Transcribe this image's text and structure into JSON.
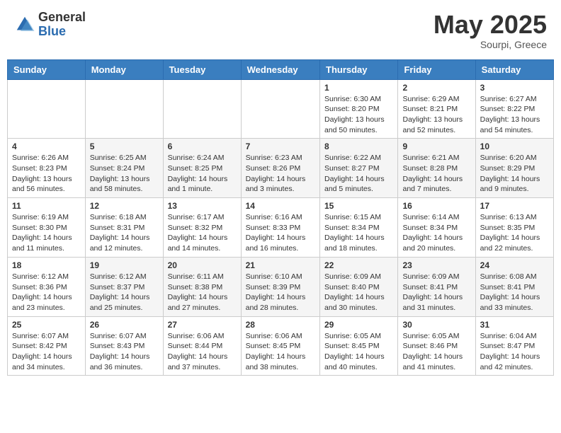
{
  "logo": {
    "general": "General",
    "blue": "Blue"
  },
  "title": "May 2025",
  "location": "Sourpi, Greece",
  "days_header": [
    "Sunday",
    "Monday",
    "Tuesday",
    "Wednesday",
    "Thursday",
    "Friday",
    "Saturday"
  ],
  "weeks": [
    [
      {
        "day": "",
        "info": ""
      },
      {
        "day": "",
        "info": ""
      },
      {
        "day": "",
        "info": ""
      },
      {
        "day": "",
        "info": ""
      },
      {
        "day": "1",
        "info": "Sunrise: 6:30 AM\nSunset: 8:20 PM\nDaylight: 13 hours\nand 50 minutes."
      },
      {
        "day": "2",
        "info": "Sunrise: 6:29 AM\nSunset: 8:21 PM\nDaylight: 13 hours\nand 52 minutes."
      },
      {
        "day": "3",
        "info": "Sunrise: 6:27 AM\nSunset: 8:22 PM\nDaylight: 13 hours\nand 54 minutes."
      }
    ],
    [
      {
        "day": "4",
        "info": "Sunrise: 6:26 AM\nSunset: 8:23 PM\nDaylight: 13 hours\nand 56 minutes."
      },
      {
        "day": "5",
        "info": "Sunrise: 6:25 AM\nSunset: 8:24 PM\nDaylight: 13 hours\nand 58 minutes."
      },
      {
        "day": "6",
        "info": "Sunrise: 6:24 AM\nSunset: 8:25 PM\nDaylight: 14 hours\nand 1 minute."
      },
      {
        "day": "7",
        "info": "Sunrise: 6:23 AM\nSunset: 8:26 PM\nDaylight: 14 hours\nand 3 minutes."
      },
      {
        "day": "8",
        "info": "Sunrise: 6:22 AM\nSunset: 8:27 PM\nDaylight: 14 hours\nand 5 minutes."
      },
      {
        "day": "9",
        "info": "Sunrise: 6:21 AM\nSunset: 8:28 PM\nDaylight: 14 hours\nand 7 minutes."
      },
      {
        "day": "10",
        "info": "Sunrise: 6:20 AM\nSunset: 8:29 PM\nDaylight: 14 hours\nand 9 minutes."
      }
    ],
    [
      {
        "day": "11",
        "info": "Sunrise: 6:19 AM\nSunset: 8:30 PM\nDaylight: 14 hours\nand 11 minutes."
      },
      {
        "day": "12",
        "info": "Sunrise: 6:18 AM\nSunset: 8:31 PM\nDaylight: 14 hours\nand 12 minutes."
      },
      {
        "day": "13",
        "info": "Sunrise: 6:17 AM\nSunset: 8:32 PM\nDaylight: 14 hours\nand 14 minutes."
      },
      {
        "day": "14",
        "info": "Sunrise: 6:16 AM\nSunset: 8:33 PM\nDaylight: 14 hours\nand 16 minutes."
      },
      {
        "day": "15",
        "info": "Sunrise: 6:15 AM\nSunset: 8:34 PM\nDaylight: 14 hours\nand 18 minutes."
      },
      {
        "day": "16",
        "info": "Sunrise: 6:14 AM\nSunset: 8:34 PM\nDaylight: 14 hours\nand 20 minutes."
      },
      {
        "day": "17",
        "info": "Sunrise: 6:13 AM\nSunset: 8:35 PM\nDaylight: 14 hours\nand 22 minutes."
      }
    ],
    [
      {
        "day": "18",
        "info": "Sunrise: 6:12 AM\nSunset: 8:36 PM\nDaylight: 14 hours\nand 23 minutes."
      },
      {
        "day": "19",
        "info": "Sunrise: 6:12 AM\nSunset: 8:37 PM\nDaylight: 14 hours\nand 25 minutes."
      },
      {
        "day": "20",
        "info": "Sunrise: 6:11 AM\nSunset: 8:38 PM\nDaylight: 14 hours\nand 27 minutes."
      },
      {
        "day": "21",
        "info": "Sunrise: 6:10 AM\nSunset: 8:39 PM\nDaylight: 14 hours\nand 28 minutes."
      },
      {
        "day": "22",
        "info": "Sunrise: 6:09 AM\nSunset: 8:40 PM\nDaylight: 14 hours\nand 30 minutes."
      },
      {
        "day": "23",
        "info": "Sunrise: 6:09 AM\nSunset: 8:41 PM\nDaylight: 14 hours\nand 31 minutes."
      },
      {
        "day": "24",
        "info": "Sunrise: 6:08 AM\nSunset: 8:41 PM\nDaylight: 14 hours\nand 33 minutes."
      }
    ],
    [
      {
        "day": "25",
        "info": "Sunrise: 6:07 AM\nSunset: 8:42 PM\nDaylight: 14 hours\nand 34 minutes."
      },
      {
        "day": "26",
        "info": "Sunrise: 6:07 AM\nSunset: 8:43 PM\nDaylight: 14 hours\nand 36 minutes."
      },
      {
        "day": "27",
        "info": "Sunrise: 6:06 AM\nSunset: 8:44 PM\nDaylight: 14 hours\nand 37 minutes."
      },
      {
        "day": "28",
        "info": "Sunrise: 6:06 AM\nSunset: 8:45 PM\nDaylight: 14 hours\nand 38 minutes."
      },
      {
        "day": "29",
        "info": "Sunrise: 6:05 AM\nSunset: 8:45 PM\nDaylight: 14 hours\nand 40 minutes."
      },
      {
        "day": "30",
        "info": "Sunrise: 6:05 AM\nSunset: 8:46 PM\nDaylight: 14 hours\nand 41 minutes."
      },
      {
        "day": "31",
        "info": "Sunrise: 6:04 AM\nSunset: 8:47 PM\nDaylight: 14 hours\nand 42 minutes."
      }
    ]
  ]
}
